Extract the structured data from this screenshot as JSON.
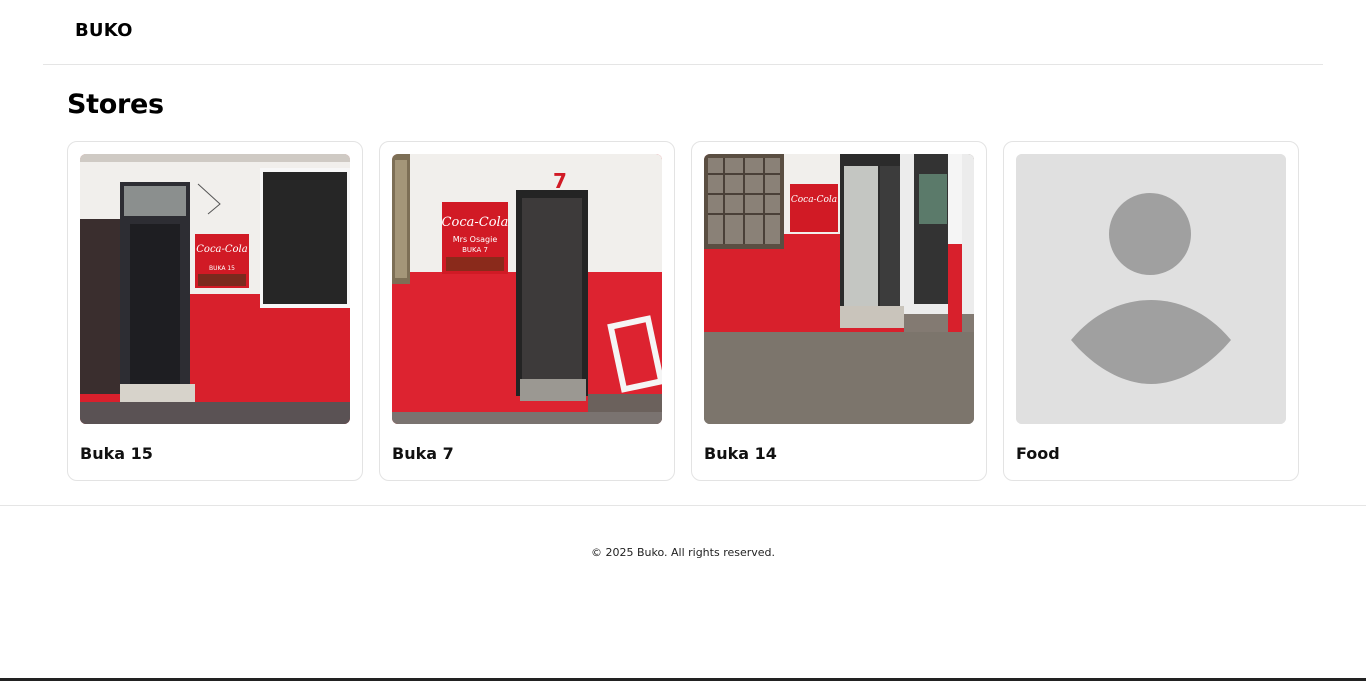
{
  "header": {
    "brand": "BUKO"
  },
  "main": {
    "title": "Stores",
    "stores": [
      {
        "name": "Buka 15",
        "image": "store-photo",
        "sign_text": "Coca-Cola",
        "sign_subtext": "BUKA 15"
      },
      {
        "name": "Buka 7",
        "image": "store-photo",
        "sign_text": "Coca-Cola",
        "sign_line1": "Mrs Osagie",
        "sign_line2": "BUKA 7",
        "door_number": "7"
      },
      {
        "name": "Buka 14",
        "image": "store-photo",
        "sign_text": "Coca-Cola"
      },
      {
        "name": "Food",
        "image": "placeholder-avatar-icon"
      }
    ]
  },
  "footer": {
    "copyright": "© 2025 Buko. All rights reserved."
  },
  "colors": {
    "wall_red": "#d8202c",
    "wall_white": "#f2f0ed",
    "placeholder_bg": "#e0e0e0",
    "placeholder_fg": "#a0a0a0"
  }
}
